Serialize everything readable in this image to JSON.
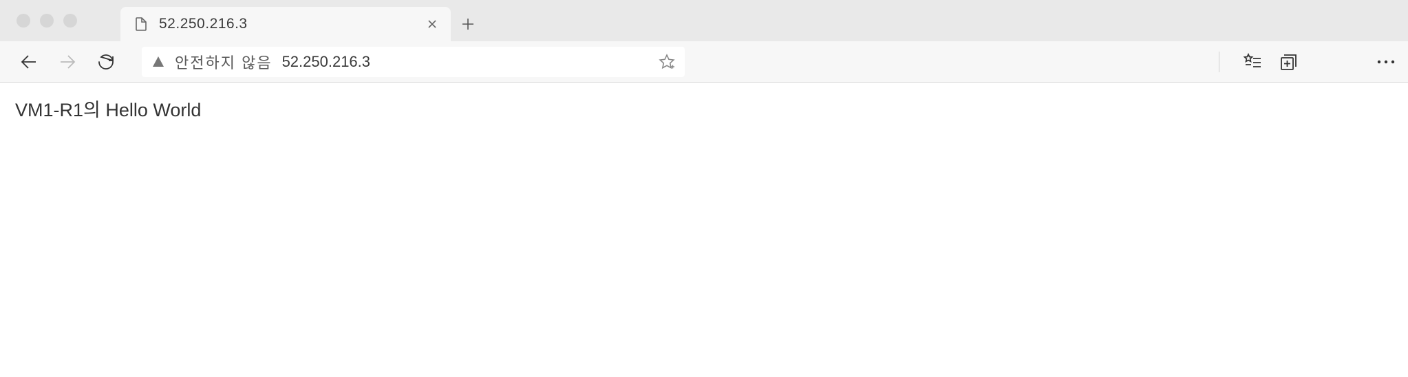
{
  "tab": {
    "title": "52.250.216.3"
  },
  "addressbar": {
    "security_label": "안전하지 않음",
    "url": "52.250.216.3"
  },
  "page": {
    "body_text": "VM1-R1의 Hello World"
  }
}
